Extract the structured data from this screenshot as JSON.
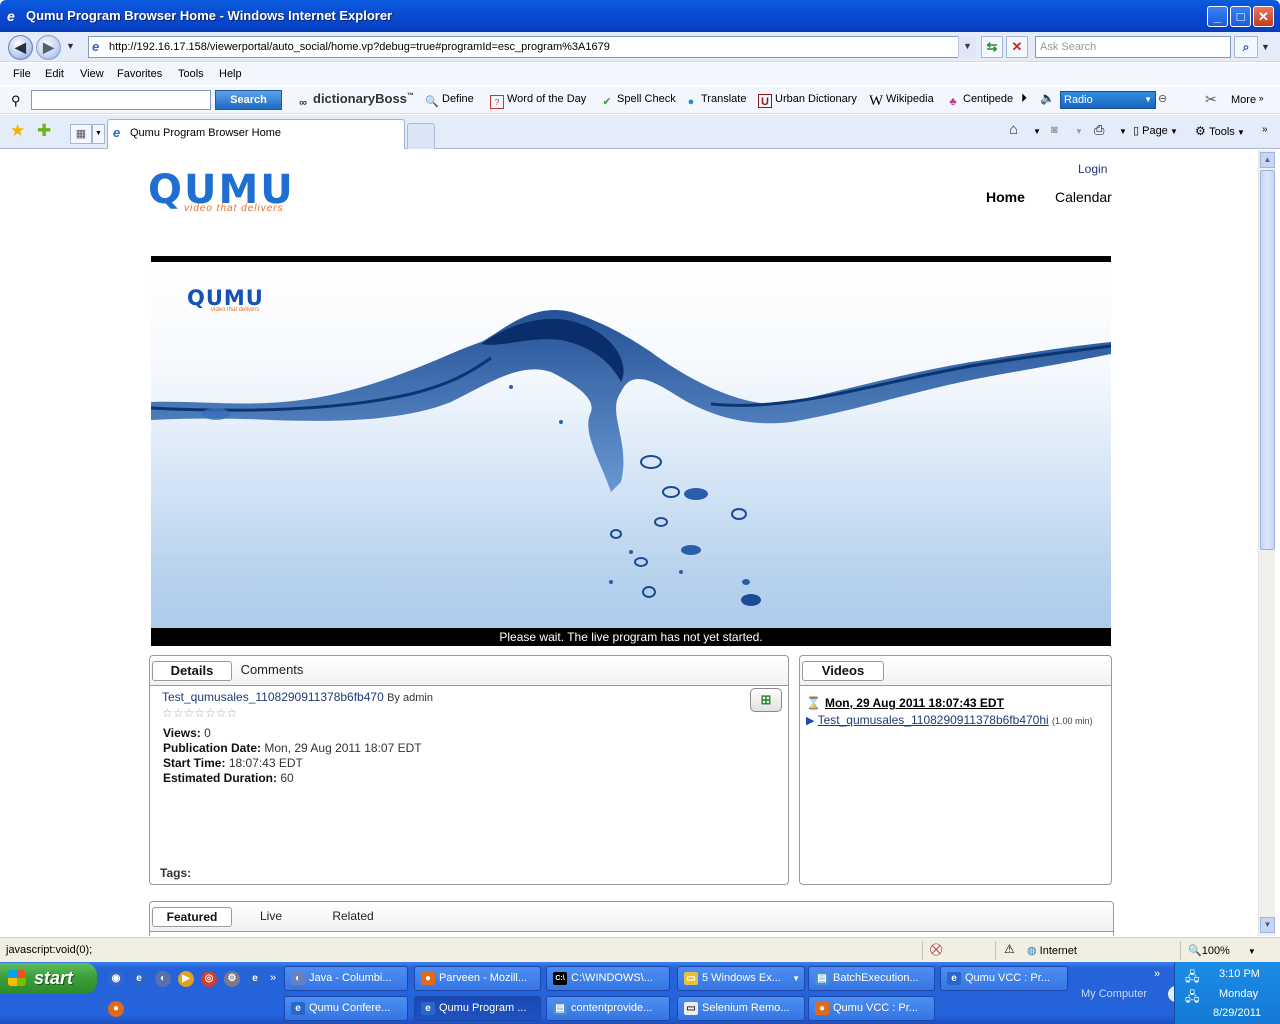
{
  "window": {
    "title": "Qumu Program Browser Home - Windows Internet Explorer",
    "min_label": "_",
    "max_label": "□",
    "close_label": "✕"
  },
  "addressbar": {
    "url": "http://192.16.17.158/viewerportal/auto_social/home.vp?debug=true#programId=esc_program%3A1679",
    "search_placeholder": "Ask Search"
  },
  "menu": [
    "File",
    "Edit",
    "View",
    "Favorites",
    "Tools",
    "Help"
  ],
  "dictionary_toolbar": {
    "search_button": "Search",
    "brand": "dictionaryBoss",
    "items": [
      "Define",
      "Word of the Day",
      "Spell Check",
      "Translate",
      "Urban Dictionary",
      "Wikipedia",
      "Centipede"
    ],
    "radio_label": "Radio",
    "more_label": "More"
  },
  "tabs": {
    "active_tab": "Qumu Program Browser Home",
    "commands": [
      "Page",
      "Tools"
    ]
  },
  "page": {
    "login": "Login",
    "nav": {
      "home": "Home",
      "calendar": "Calendar"
    },
    "logo": {
      "mark": "QUMU",
      "tagline": "video that delivers"
    },
    "player_status": "Please wait. The live program has not yet started.",
    "details_panel": {
      "tabs": [
        "Details",
        "Comments"
      ],
      "title": "Test_qumusales_1108290911378b6fb470",
      "by": "By admin",
      "rating": "☆☆☆☆☆☆☆",
      "fields": [
        {
          "label": "Views:",
          "value": "0"
        },
        {
          "label": "Publication Date:",
          "value": "Mon, 29 Aug 2011 18:07 EDT"
        },
        {
          "label": "Start Time:",
          "value": "18:07:43 EDT"
        },
        {
          "label": "Estimated Duration:",
          "value": "60"
        }
      ],
      "tags_label": "Tags:"
    },
    "videos_panel": {
      "tab": "Videos",
      "date": "Mon, 29 Aug 2011 18:07:43 EDT",
      "video_link": "Test_qumusales_1108290911378b6fb470hi",
      "duration": "(1.00 min)"
    },
    "bottom_panel": {
      "tabs": [
        "Featured",
        "Live",
        "Related"
      ]
    }
  },
  "statusbar": {
    "text": "javascript:void(0);",
    "zone": "Internet",
    "zoom": "100%"
  },
  "taskbar": {
    "start": "start",
    "row1": [
      "Java - Columbi...",
      "Parveen - Mozill...",
      "C:\\WINDOWS\\...",
      "5 Windows Ex...",
      "BatchExecution...",
      "Qumu VCC : Pr..."
    ],
    "row2": [
      "Qumu Confere...",
      "Qumu Program ...",
      "contentprovide...",
      "Selenium Remo...",
      "Qumu VCC : Pr..."
    ],
    "my_computer": "My Computer",
    "time": "3:10 PM",
    "day": "Monday",
    "date": "8/29/2011"
  }
}
